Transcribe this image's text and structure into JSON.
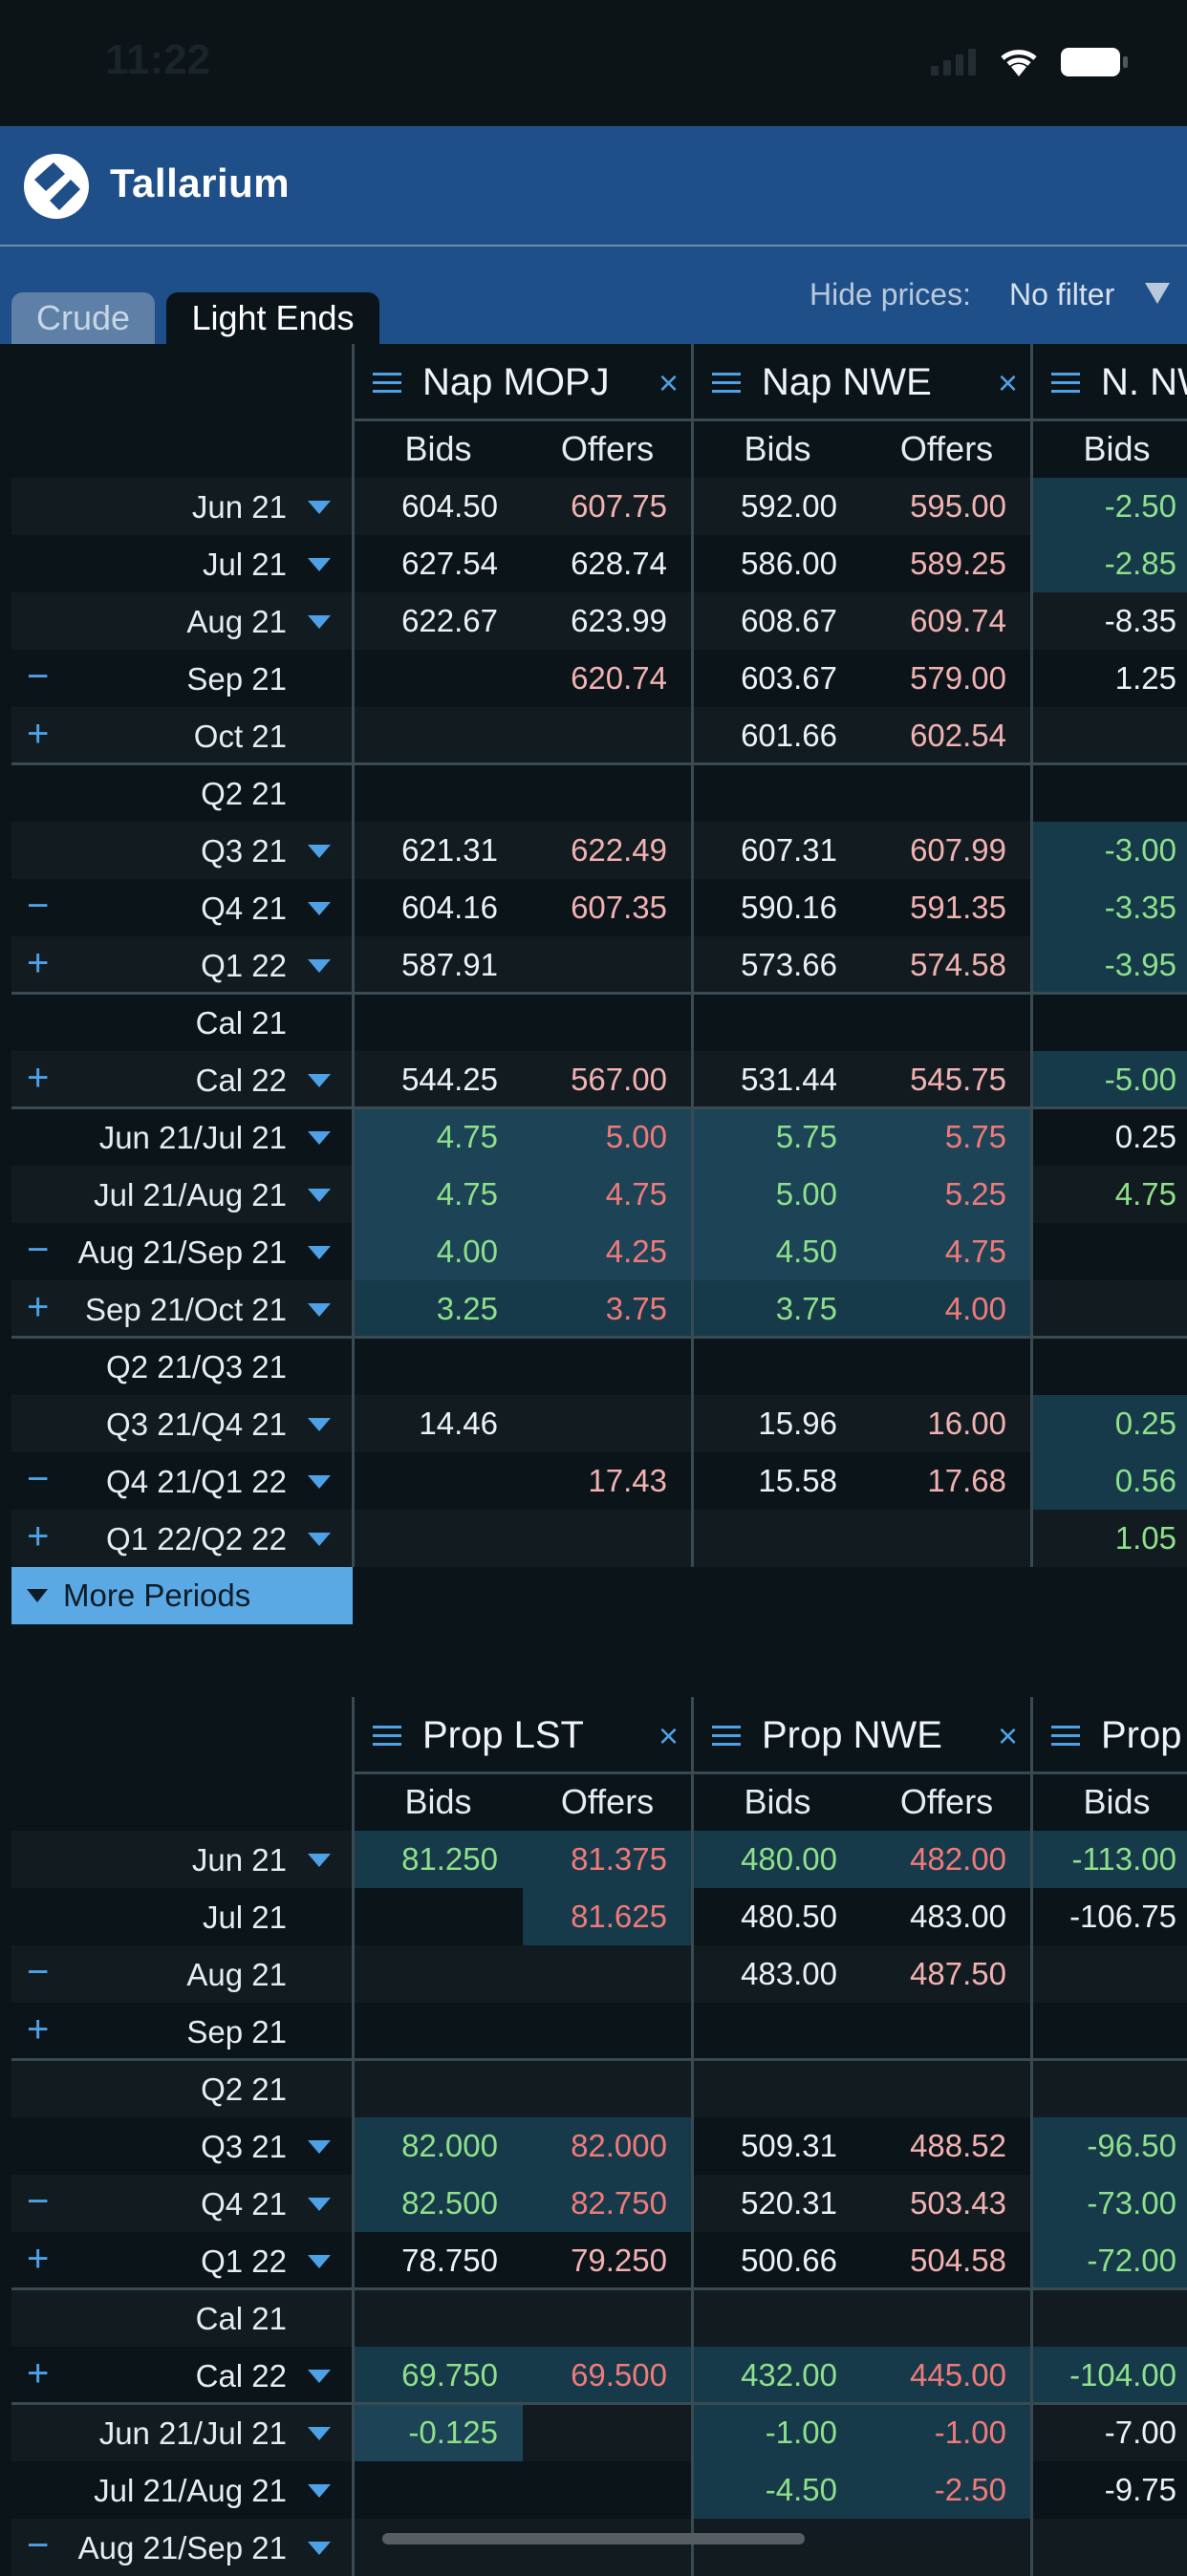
{
  "status": {
    "time": "11:22"
  },
  "app": {
    "brand": "Tallarium"
  },
  "tabs": [
    {
      "label": "Crude"
    },
    {
      "label": "Light Ends"
    }
  ],
  "filter": {
    "label": "Hide prices:",
    "value": "No filter"
  },
  "headers": {
    "bids": "Bids",
    "offers": "Offers"
  },
  "table1": {
    "products": [
      {
        "name": "Nap MOPJ",
        "closable": true
      },
      {
        "name": "Nap NWE",
        "closable": true
      },
      {
        "name": "N. NWE",
        "closable": false
      }
    ],
    "rows": [
      {
        "label": "Jun 21",
        "caret": true,
        "pm": "",
        "cells": [
          [
            "604.50",
            "w"
          ],
          [
            "607.75",
            "p"
          ],
          [
            "592.00",
            "w"
          ],
          [
            "595.00",
            "p"
          ],
          [
            "-2.50",
            "g"
          ]
        ],
        "hl": [
          0,
          0,
          0,
          0,
          1
        ]
      },
      {
        "label": "Jul 21",
        "caret": true,
        "pm": "",
        "cells": [
          [
            "627.54",
            "w"
          ],
          [
            "628.74",
            "w"
          ],
          [
            "586.00",
            "w"
          ],
          [
            "589.25",
            "p"
          ],
          [
            "-2.85",
            "g"
          ]
        ],
        "hl": [
          0,
          0,
          0,
          0,
          1
        ]
      },
      {
        "label": "Aug 21",
        "caret": true,
        "pm": "",
        "cells": [
          [
            "622.67",
            "w"
          ],
          [
            "623.99",
            "w"
          ],
          [
            "608.67",
            "w"
          ],
          [
            "609.74",
            "p"
          ],
          [
            "-8.35",
            "w"
          ]
        ],
        "hl": [
          0,
          0,
          0,
          0,
          0
        ]
      },
      {
        "label": "Sep 21",
        "caret": false,
        "pm": "−",
        "cells": [
          [
            "",
            ""
          ],
          [
            "620.74",
            "p"
          ],
          [
            "603.67",
            "w"
          ],
          [
            "579.00",
            "p"
          ],
          [
            "1.25",
            "w"
          ]
        ],
        "hl": [
          0,
          0,
          0,
          0,
          0
        ]
      },
      {
        "label": "Oct 21",
        "caret": false,
        "pm": "+",
        "cells": [
          [
            "",
            ""
          ],
          [
            "",
            ""
          ],
          [
            "601.66",
            "w"
          ],
          [
            "602.54",
            "p"
          ],
          [
            "",
            ""
          ]
        ],
        "hl": [
          0,
          0,
          0,
          0,
          0
        ]
      },
      {
        "label": "Q2 21",
        "caret": false,
        "pm": "",
        "group": true,
        "cells": [
          [
            "",
            ""
          ],
          [
            "",
            ""
          ],
          [
            "",
            ""
          ],
          [
            "",
            ""
          ],
          [
            "",
            ""
          ]
        ],
        "hl": [
          0,
          0,
          0,
          0,
          0
        ]
      },
      {
        "label": "Q3 21",
        "caret": true,
        "pm": "",
        "cells": [
          [
            "621.31",
            "w"
          ],
          [
            "622.49",
            "p"
          ],
          [
            "607.31",
            "w"
          ],
          [
            "607.99",
            "p"
          ],
          [
            "-3.00",
            "g"
          ]
        ],
        "hl": [
          0,
          0,
          0,
          0,
          1
        ]
      },
      {
        "label": "Q4 21",
        "caret": true,
        "pm": "−",
        "cells": [
          [
            "604.16",
            "w"
          ],
          [
            "607.35",
            "p"
          ],
          [
            "590.16",
            "w"
          ],
          [
            "591.35",
            "p"
          ],
          [
            "-3.35",
            "g"
          ]
        ],
        "hl": [
          0,
          0,
          0,
          0,
          1
        ]
      },
      {
        "label": "Q1 22",
        "caret": true,
        "pm": "+",
        "cells": [
          [
            "587.91",
            "w"
          ],
          [
            "",
            ""
          ],
          [
            "573.66",
            "w"
          ],
          [
            "574.58",
            "p"
          ],
          [
            "-3.95",
            "g"
          ]
        ],
        "hl": [
          0,
          0,
          0,
          0,
          1
        ]
      },
      {
        "label": "Cal 21",
        "caret": false,
        "pm": "",
        "group": true,
        "cells": [
          [
            "",
            ""
          ],
          [
            "",
            ""
          ],
          [
            "",
            ""
          ],
          [
            "",
            ""
          ],
          [
            "",
            ""
          ]
        ],
        "hl": [
          0,
          0,
          0,
          0,
          0
        ]
      },
      {
        "label": "Cal 22",
        "caret": true,
        "pm": "+",
        "cells": [
          [
            "544.25",
            "w"
          ],
          [
            "567.00",
            "p"
          ],
          [
            "531.44",
            "w"
          ],
          [
            "545.75",
            "p"
          ],
          [
            "-5.00",
            "g"
          ]
        ],
        "hl": [
          0,
          0,
          0,
          0,
          1
        ]
      },
      {
        "label": "Jun 21/Jul 21",
        "caret": true,
        "pm": "",
        "group": true,
        "cells": [
          [
            "4.75",
            "g"
          ],
          [
            "5.00",
            "r"
          ],
          [
            "5.75",
            "g"
          ],
          [
            "5.75",
            "r"
          ],
          [
            "0.25",
            "w"
          ]
        ],
        "hl": [
          2,
          2,
          2,
          2,
          0
        ]
      },
      {
        "label": "Jul 21/Aug 21",
        "caret": true,
        "pm": "",
        "cells": [
          [
            "4.75",
            "g"
          ],
          [
            "4.75",
            "r"
          ],
          [
            "5.00",
            "g"
          ],
          [
            "5.25",
            "r"
          ],
          [
            "4.75",
            "g"
          ]
        ],
        "hl": [
          2,
          2,
          2,
          2,
          0
        ]
      },
      {
        "label": "Aug 21/Sep 21",
        "caret": true,
        "pm": "−",
        "cells": [
          [
            "4.00",
            "g"
          ],
          [
            "4.25",
            "r"
          ],
          [
            "4.50",
            "g"
          ],
          [
            "4.75",
            "r"
          ],
          [
            "",
            ""
          ]
        ],
        "hl": [
          2,
          2,
          2,
          2,
          0
        ]
      },
      {
        "label": "Sep 21/Oct 21",
        "caret": true,
        "pm": "+",
        "cells": [
          [
            "3.25",
            "g"
          ],
          [
            "3.75",
            "r"
          ],
          [
            "3.75",
            "g"
          ],
          [
            "4.00",
            "r"
          ],
          [
            "",
            ""
          ]
        ],
        "hl": [
          1,
          1,
          1,
          1,
          0
        ]
      },
      {
        "label": "Q2 21/Q3 21",
        "caret": false,
        "pm": "",
        "group": true,
        "cells": [
          [
            "",
            ""
          ],
          [
            "",
            ""
          ],
          [
            "",
            ""
          ],
          [
            "",
            ""
          ],
          [
            "",
            ""
          ]
        ],
        "hl": [
          0,
          0,
          0,
          0,
          0
        ]
      },
      {
        "label": "Q3 21/Q4 21",
        "caret": true,
        "pm": "",
        "cells": [
          [
            "14.46",
            "w"
          ],
          [
            "",
            ""
          ],
          [
            "15.96",
            "w"
          ],
          [
            "16.00",
            "p"
          ],
          [
            "0.25",
            "g"
          ]
        ],
        "hl": [
          0,
          0,
          0,
          0,
          1
        ]
      },
      {
        "label": "Q4 21/Q1 22",
        "caret": true,
        "pm": "−",
        "cells": [
          [
            "",
            ""
          ],
          [
            "17.43",
            "p"
          ],
          [
            "15.58",
            "w"
          ],
          [
            "17.68",
            "p"
          ],
          [
            "0.56",
            "g"
          ]
        ],
        "hl": [
          0,
          0,
          0,
          0,
          1
        ]
      },
      {
        "label": "Q1 22/Q2 22",
        "caret": true,
        "pm": "+",
        "cells": [
          [
            "",
            ""
          ],
          [
            "",
            ""
          ],
          [
            "",
            ""
          ],
          [
            "",
            ""
          ],
          [
            "1.05",
            "g"
          ]
        ],
        "hl": [
          0,
          0,
          0,
          0,
          0
        ]
      }
    ],
    "more": "More Periods"
  },
  "table2": {
    "products": [
      {
        "name": "Prop LST",
        "closable": true
      },
      {
        "name": "Prop NWE",
        "closable": true
      },
      {
        "name": "Prop",
        "closable": false
      }
    ],
    "rows": [
      {
        "label": "Jun 21",
        "caret": true,
        "pm": "",
        "cells": [
          [
            "81.250",
            "g"
          ],
          [
            "81.375",
            "r"
          ],
          [
            "480.00",
            "g"
          ],
          [
            "482.00",
            "r"
          ],
          [
            "-113.00",
            "g"
          ]
        ],
        "hl": [
          1,
          1,
          1,
          1,
          1
        ]
      },
      {
        "label": "Jul 21",
        "caret": false,
        "pm": "",
        "cells": [
          [
            "",
            ""
          ],
          [
            "81.625",
            "r"
          ],
          [
            "480.50",
            "w"
          ],
          [
            "483.00",
            "w"
          ],
          [
            "-106.75",
            "w"
          ]
        ],
        "hl": [
          0,
          1,
          0,
          0,
          0
        ]
      },
      {
        "label": "Aug 21",
        "caret": false,
        "pm": "−",
        "cells": [
          [
            "",
            ""
          ],
          [
            "",
            ""
          ],
          [
            "483.00",
            "w"
          ],
          [
            "487.50",
            "p"
          ],
          [
            "",
            ""
          ]
        ],
        "hl": [
          0,
          0,
          0,
          0,
          0
        ]
      },
      {
        "label": "Sep 21",
        "caret": false,
        "pm": "+",
        "cells": [
          [
            "",
            ""
          ],
          [
            "",
            ""
          ],
          [
            "",
            ""
          ],
          [
            "",
            ""
          ],
          [
            "",
            ""
          ]
        ],
        "hl": [
          0,
          0,
          0,
          0,
          0
        ]
      },
      {
        "label": "Q2 21",
        "caret": false,
        "pm": "",
        "group": true,
        "cells": [
          [
            "",
            ""
          ],
          [
            "",
            ""
          ],
          [
            "",
            ""
          ],
          [
            "",
            ""
          ],
          [
            "",
            ""
          ]
        ],
        "hl": [
          0,
          0,
          0,
          0,
          0
        ]
      },
      {
        "label": "Q3 21",
        "caret": true,
        "pm": "",
        "cells": [
          [
            "82.000",
            "g"
          ],
          [
            "82.000",
            "r"
          ],
          [
            "509.31",
            "w"
          ],
          [
            "488.52",
            "p"
          ],
          [
            "-96.50",
            "g"
          ]
        ],
        "hl": [
          1,
          1,
          0,
          0,
          1
        ]
      },
      {
        "label": "Q4 21",
        "caret": true,
        "pm": "−",
        "cells": [
          [
            "82.500",
            "g"
          ],
          [
            "82.750",
            "r"
          ],
          [
            "520.31",
            "w"
          ],
          [
            "503.43",
            "p"
          ],
          [
            "-73.00",
            "g"
          ]
        ],
        "hl": [
          1,
          1,
          0,
          0,
          1
        ]
      },
      {
        "label": "Q1 22",
        "caret": true,
        "pm": "+",
        "cells": [
          [
            "78.750",
            "w"
          ],
          [
            "79.250",
            "p"
          ],
          [
            "500.66",
            "w"
          ],
          [
            "504.58",
            "p"
          ],
          [
            "-72.00",
            "g"
          ]
        ],
        "hl": [
          0,
          0,
          0,
          0,
          1
        ]
      },
      {
        "label": "Cal 21",
        "caret": false,
        "pm": "",
        "group": true,
        "cells": [
          [
            "",
            ""
          ],
          [
            "",
            ""
          ],
          [
            "",
            ""
          ],
          [
            "",
            ""
          ],
          [
            "",
            ""
          ]
        ],
        "hl": [
          0,
          0,
          0,
          0,
          0
        ]
      },
      {
        "label": "Cal 22",
        "caret": true,
        "pm": "+",
        "cells": [
          [
            "69.750",
            "g"
          ],
          [
            "69.500",
            "r"
          ],
          [
            "432.00",
            "g"
          ],
          [
            "445.00",
            "r"
          ],
          [
            "-104.00",
            "g"
          ]
        ],
        "hl": [
          1,
          1,
          1,
          1,
          1
        ]
      },
      {
        "label": "Jun 21/Jul 21",
        "caret": true,
        "pm": "",
        "group": true,
        "cells": [
          [
            "-0.125",
            "g"
          ],
          [
            "",
            ""
          ],
          [
            "-1.00",
            "g"
          ],
          [
            "-1.00",
            "r"
          ],
          [
            "-7.00",
            "w"
          ]
        ],
        "hl": [
          2,
          0,
          1,
          1,
          0
        ]
      },
      {
        "label": "Jul 21/Aug 21",
        "caret": true,
        "pm": "",
        "cells": [
          [
            "",
            ""
          ],
          [
            "",
            ""
          ],
          [
            "-4.50",
            "g"
          ],
          [
            "-2.50",
            "r"
          ],
          [
            "-9.75",
            "w"
          ]
        ],
        "hl": [
          0,
          0,
          1,
          1,
          0
        ]
      },
      {
        "label": "Aug 21/Sep 21",
        "caret": true,
        "pm": "−",
        "cells": [
          [
            "",
            ""
          ],
          [
            "",
            ""
          ],
          [
            "",
            ""
          ],
          [
            "",
            ""
          ],
          [
            "",
            ""
          ]
        ],
        "hl": [
          0,
          0,
          0,
          0,
          0
        ]
      }
    ]
  }
}
